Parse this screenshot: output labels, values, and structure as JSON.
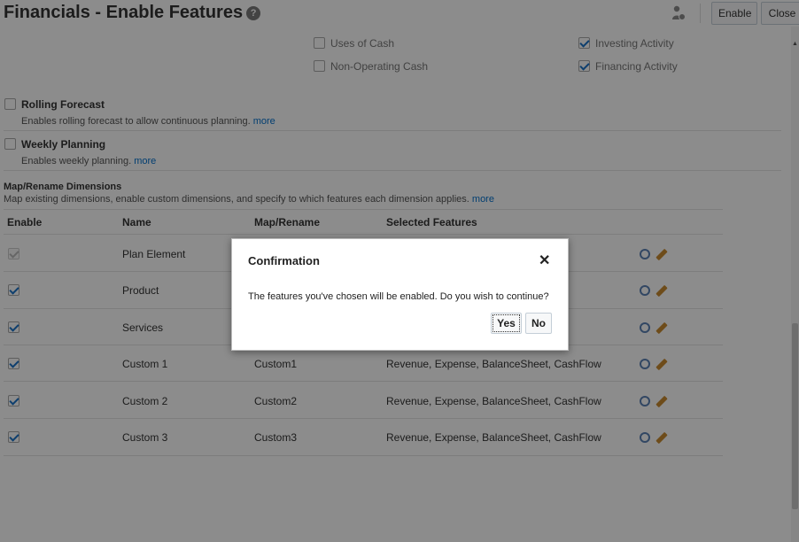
{
  "header": {
    "title": "Financials - Enable Features",
    "help_icon": "?",
    "enable_label": "Enable",
    "close_label": "Close"
  },
  "cash_flow": {
    "uses_of_cash": {
      "label": "Uses of Cash",
      "checked": false
    },
    "non_operating_cash": {
      "label": "Non-Operating Cash",
      "checked": false
    },
    "investing_activity": {
      "label": "Investing Activity",
      "checked": true
    },
    "financing_activity": {
      "label": "Financing Activity",
      "checked": true
    }
  },
  "features": {
    "rolling_forecast": {
      "label": "Rolling Forecast",
      "description": "Enables rolling forecast to allow continuous planning.",
      "more": "more",
      "checked": false
    },
    "weekly_planning": {
      "label": "Weekly Planning",
      "description": "Enables weekly planning.",
      "more": "more",
      "checked": false
    }
  },
  "map_rename": {
    "title": "Map/Rename Dimensions",
    "description": "Map existing dimensions, enable custom dimensions, and specify to which features each dimension applies.",
    "more": "more",
    "columns": [
      "Enable",
      "Name",
      "Map/Rename",
      "Selected Features"
    ],
    "rows": [
      {
        "enabled": true,
        "disabled": true,
        "name": "Plan Element",
        "map": "",
        "features": ""
      },
      {
        "enabled": true,
        "disabled": false,
        "name": "Product",
        "map": "",
        "features": ""
      },
      {
        "enabled": true,
        "disabled": false,
        "name": "Services",
        "map": "",
        "features": ""
      },
      {
        "enabled": true,
        "disabled": false,
        "name": "Custom 1",
        "map": "Custom1",
        "features": "Revenue, Expense, BalanceSheet, CashFlow"
      },
      {
        "enabled": true,
        "disabled": false,
        "name": "Custom 2",
        "map": "Custom2",
        "features": "Revenue, Expense, BalanceSheet, CashFlow"
      },
      {
        "enabled": true,
        "disabled": false,
        "name": "Custom 3",
        "map": "Custom3",
        "features": "Revenue, Expense, BalanceSheet, CashFlow"
      }
    ]
  },
  "dialog": {
    "title": "Confirmation",
    "close": "✕",
    "message": "The features you've chosen will be enabled. Do you wish to continue?",
    "yes_label": "Yes",
    "no_label": "No"
  }
}
